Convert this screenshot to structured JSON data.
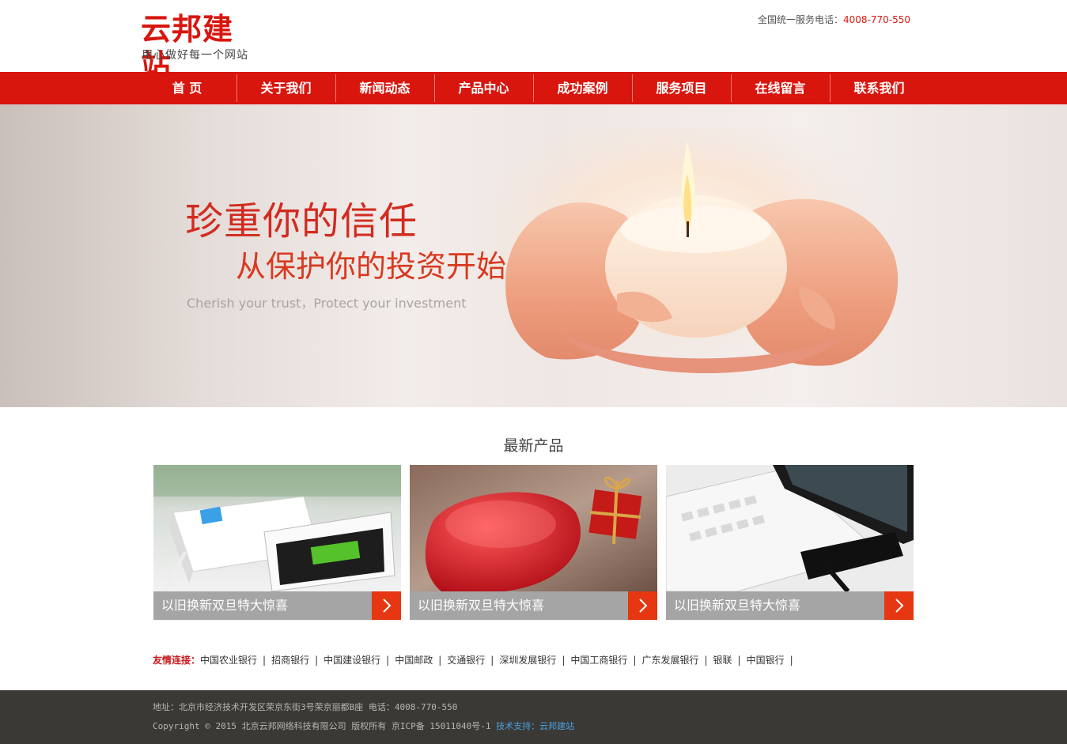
{
  "header": {
    "logo_main": "云邦建站",
    "logo_sub": "用心做好每一个网站",
    "hotline_label": "全国统一服务电话：",
    "hotline_number": "4008-770-550"
  },
  "nav": {
    "items": [
      "首 页",
      "关于我们",
      "新闻动态",
      "产品中心",
      "成功案例",
      "服务项目",
      "在线留言",
      "联系我们"
    ]
  },
  "banner": {
    "title1": "珍重你的信任",
    "title2": "从保护你的投资开始",
    "subtitle": "Cherish your trust，Protect your investment"
  },
  "products": {
    "section_title": "最新产品",
    "items": [
      {
        "caption": "以旧换新双旦特大惊喜"
      },
      {
        "caption": "以旧换新双旦特大惊喜"
      },
      {
        "caption": "以旧换新双旦特大惊喜"
      }
    ]
  },
  "links": {
    "label": "友情连接：",
    "items": [
      "中国农业银行",
      "招商银行",
      "中国建设银行",
      "中国邮政",
      "交通银行",
      "深圳发展银行",
      "中国工商银行",
      "广东发展银行",
      "银联",
      "中国银行"
    ]
  },
  "footer": {
    "address": "地址：北京市经济技术开发区荣京东街3号荣京丽都B座 电话：4008-770-550",
    "copyright": "Copyright © 2015 北京云邦网络科技有限公司 版权所有 京ICP备 15011040号-1",
    "tech_support": "技术支持：云邦建站"
  },
  "colors": {
    "brand_red": "#d8160e",
    "arrow_orange": "#e63712",
    "caption_gray": "#a5a5a5",
    "footer_bg": "#3b3936",
    "tech_link_blue": "#4aa3e0"
  },
  "icons": {
    "product_arrow": "chevron-right-icon"
  }
}
